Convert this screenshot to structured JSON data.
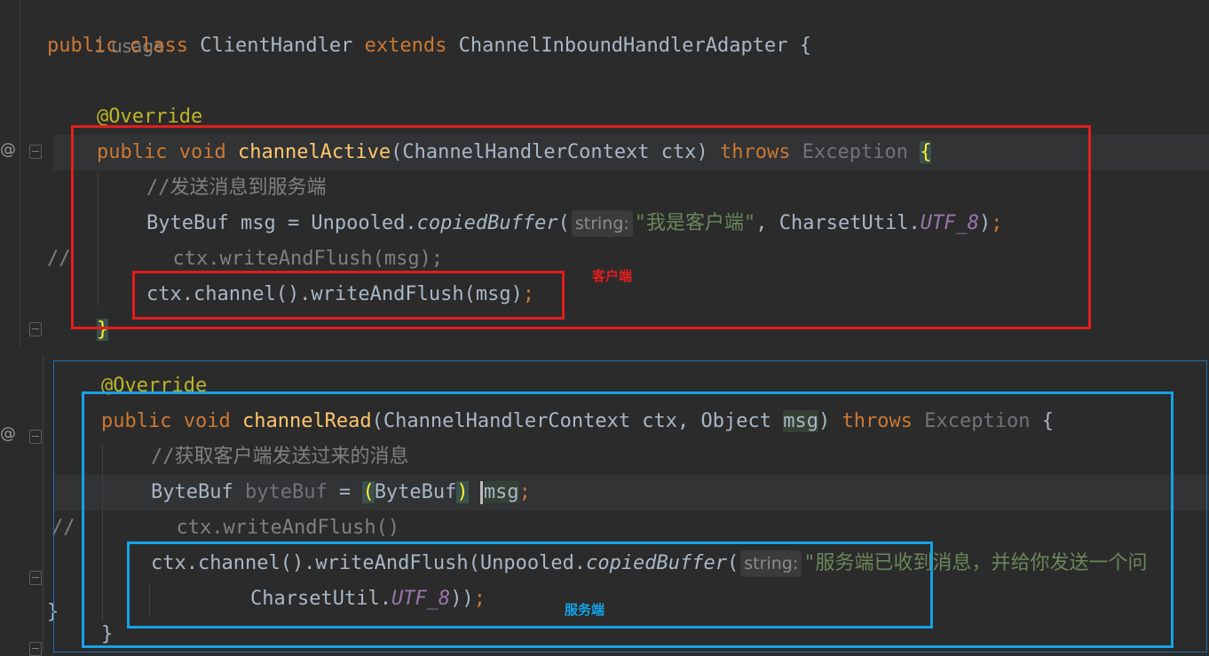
{
  "usage_hint": "1 usage",
  "code": {
    "class_line": {
      "kw_public": "public",
      "kw_class": "class",
      "class_name": "ClientHandler",
      "kw_extends": "extends",
      "super_name": "ChannelInboundHandlerAdapter",
      "brace": "{"
    },
    "override_1": "@Override",
    "active_sig": {
      "kw_public": "public",
      "kw_void": "void",
      "method": "channelActive",
      "params": "(ChannelHandlerContext ctx)",
      "kw_throws": "throws",
      "exception": "Exception",
      "brace": "{"
    },
    "comment_send": "//发送消息到服务端",
    "bytebuf_line": {
      "prefix": "ByteBuf msg = Unpooled.",
      "method": "copiedBuffer",
      "open": "(",
      "hint": "string:",
      "string": "\"我是客户端\"",
      "sep": ", CharsetUtil.",
      "const": "UTF_8",
      "close": ")",
      "semi": ";"
    },
    "commented_line_1": {
      "slashes": "//",
      "code": "ctx.writeAndFlush(msg);"
    },
    "client_flush": {
      "code": "ctx.channel().writeAndFlush(msg)",
      "semi": ";"
    },
    "close_brace_1": "}",
    "override_2": "@Override",
    "read_sig": {
      "kw_public": "public",
      "kw_void": "void",
      "method": "channelRead",
      "params_a": "(ChannelHandlerContext ctx, Object ",
      "msg": "msg",
      "params_b": ")",
      "kw_throws": "throws",
      "exception": "Exception",
      "brace": "{"
    },
    "comment_get": "//获取客户端发送过来的消息",
    "cast_line": {
      "type": "ByteBuf",
      "var": "byteBuf",
      "eq": " = ",
      "open": "(",
      "cast": "ByteBuf",
      "close": ")",
      "msg": "msg",
      "semi": ";"
    },
    "commented_line_2": {
      "slashes": "//",
      "code": "ctx.writeAndFlush()"
    },
    "server_flush_1": {
      "prefix": "ctx.channel().writeAndFlush(Unpooled.",
      "method": "copiedBuffer",
      "open": "(",
      "hint": "string:",
      "string": "\"服务端已收到消息，并给你发送一个问"
    },
    "server_flush_2": {
      "prefix": "CharsetUtil.",
      "const": "UTF_8",
      "close": "))",
      "semi": ";"
    },
    "close_brace_2": "}",
    "close_brace_outer": "}"
  },
  "gutter": {
    "override_icon_1": "@",
    "override_icon_2": "@"
  },
  "annotations": {
    "client_label": "客户端",
    "server_label": "服务端",
    "red_color": "#e31d1d",
    "blue_color": "#16a2e6"
  }
}
